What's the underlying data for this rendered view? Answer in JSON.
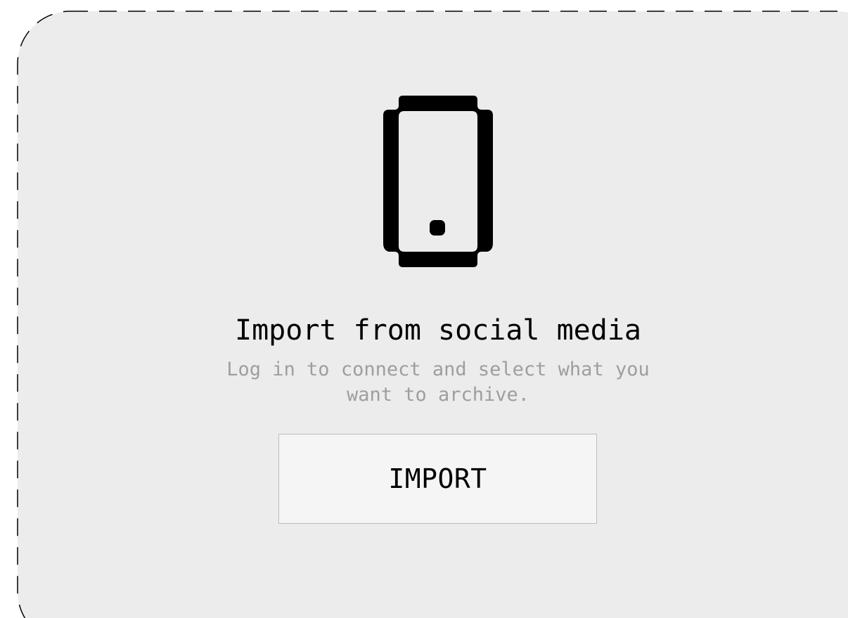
{
  "import_card": {
    "icon": "mobile-phone-icon",
    "title": "Import from social media",
    "description": "Log in to connect and select what you want to archive.",
    "button_label": "IMPORT"
  },
  "colors": {
    "card_background": "#ececec",
    "border": "#000000",
    "title_text": "#000000",
    "description_text": "#9e9e9e",
    "button_background": "#f5f5f5",
    "button_border": "#bdbdbd"
  }
}
